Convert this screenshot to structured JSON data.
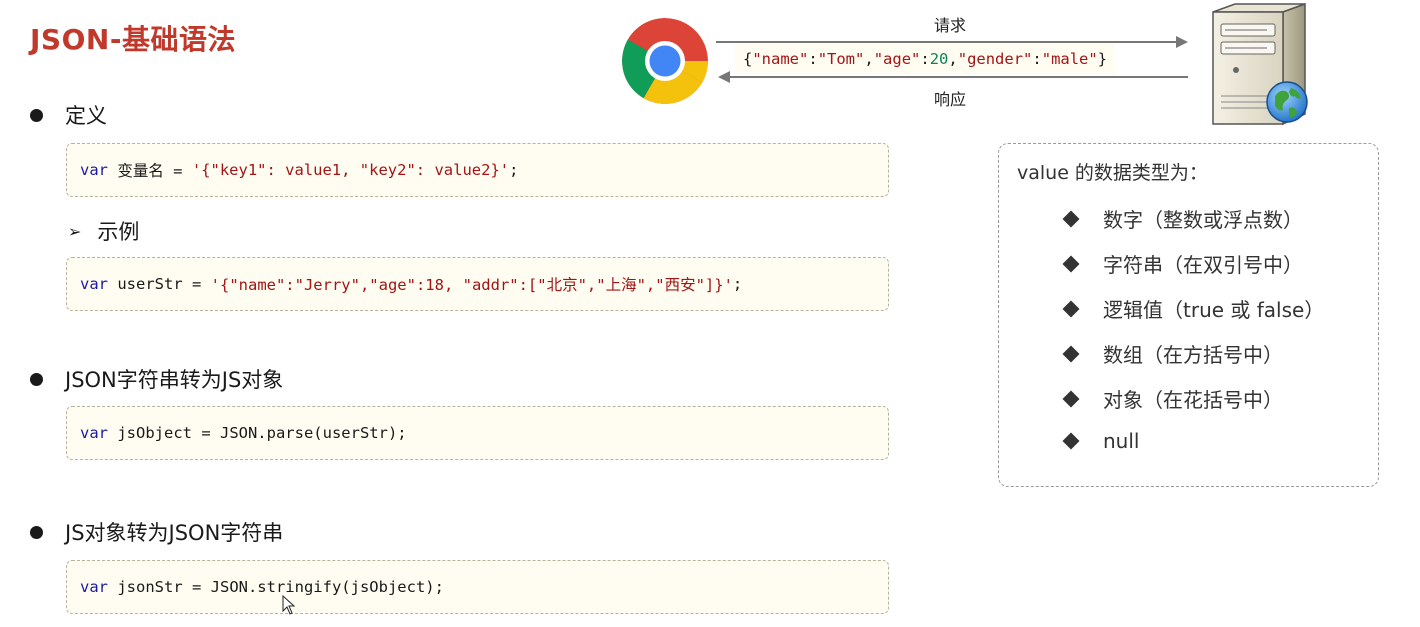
{
  "slide": {
    "title": "JSON-基础语法"
  },
  "diagram": {
    "request_label": "请求",
    "response_label": "响应",
    "json_sample": {
      "open": "{",
      "k1": "\"name\"",
      "c1": ":",
      "v1": "\"Tom\"",
      "sep1": ",",
      "k2": "\"age\"",
      "c2": ":",
      "v2": "20",
      "sep2": ",",
      "k3": "\"gender\"",
      "c3": ":",
      "v3": "\"male\"",
      "close": "}"
    }
  },
  "sections": {
    "definition": {
      "label": "定义",
      "code": {
        "kw": "var",
        "rest": " 变量名 = ",
        "str": "'{\"key1\": value1, \"key2\": value2}'",
        "end": ";"
      }
    },
    "example": {
      "label": "示例",
      "code": {
        "kw": "var",
        "rest": " userStr = ",
        "str": "'{\"name\":\"Jerry\",\"age\":18, \"addr\":[\"北京\",\"上海\",\"西安\"]}'",
        "end": ";"
      }
    },
    "parse": {
      "label": "JSON字符串转为JS对象",
      "code": {
        "kw": "var",
        "rest": " jsObject = JSON.parse(userStr);"
      }
    },
    "stringify": {
      "label": "JS对象转为JSON字符串",
      "code": {
        "kw": "var",
        "rest": " jsonStr = JSON.stringify(jsObject);"
      }
    }
  },
  "value_types": {
    "title": "value 的数据类型为：",
    "items": [
      "数字（整数或浮点数）",
      "字符串（在双引号中）",
      "逻辑值（true 或 false）",
      "数组（在方括号中）",
      "对象（在花括号中）",
      "null"
    ]
  },
  "icons": {
    "browser": "chrome-icon",
    "server": "server-icon",
    "cursor": "mouse-cursor-icon"
  },
  "colors": {
    "title": "#c0392b",
    "keyword": "#1a1aa6",
    "string": "#a31515",
    "number": "#098658",
    "code_bg": "#fffdf2"
  }
}
